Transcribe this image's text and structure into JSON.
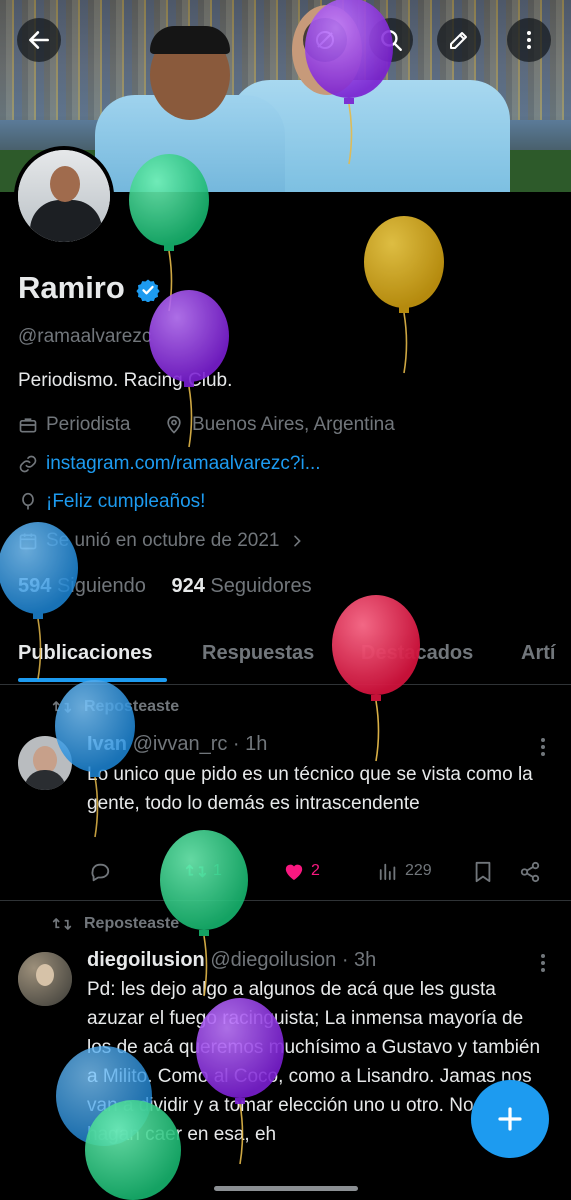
{
  "header": {
    "back_icon": "arrow-left-icon",
    "search_icon": "search-icon",
    "edit_icon": "edit-icon",
    "more_icon": "more-vertical-icon"
  },
  "profile": {
    "name": "Ramiro",
    "handle": "@ramaalvarezc",
    "bio": "Periodismo.  Racing Club.",
    "profession": "Periodista",
    "location": "Buenos Aires, Argentina",
    "website": "instagram.com/ramaalvarezc?i...",
    "birthday": "¡Feliz cumpleaños!",
    "joined": "Se unió en octubre de 2021",
    "following_count": "594",
    "following_label": "Siguiendo",
    "followers_count": "924",
    "followers_label": "Seguidores"
  },
  "tabs": [
    {
      "label": "Publicaciones"
    },
    {
      "label": "Respuestas"
    },
    {
      "label": "Destacados"
    },
    {
      "label": "Artí"
    }
  ],
  "posts": [
    {
      "repost_label": "Reposteaste",
      "author_name": "Ivan",
      "author_handle": "@ivvan_rc · 1h",
      "text": "Lo unico que pido es un técnico que se vista como la gente, todo lo demás es intrascendente",
      "retweets": "1",
      "likes": "2",
      "views": "229"
    },
    {
      "repost_label": "Reposteaste",
      "author_name": "diegoilusion",
      "author_handle": "@diegoilusion · 3h",
      "text": "Pd: les dejo algo a algunos de acá que les gusta azuzar el fuego racinguista; La inmensa mayoría de los de acá queremos muchísimo a Gustavo y también a Milito. Como al Coco, como a Lisandro. Jamas nos van a dividir y a tomar elección uno u otro. No nos hagan caer en esa, eh"
    }
  ],
  "colors": {
    "accent": "#1d9bf0",
    "like": "#f91880",
    "background": "#000000",
    "muted": "#71767b"
  },
  "fab_icon": "plus-icon"
}
